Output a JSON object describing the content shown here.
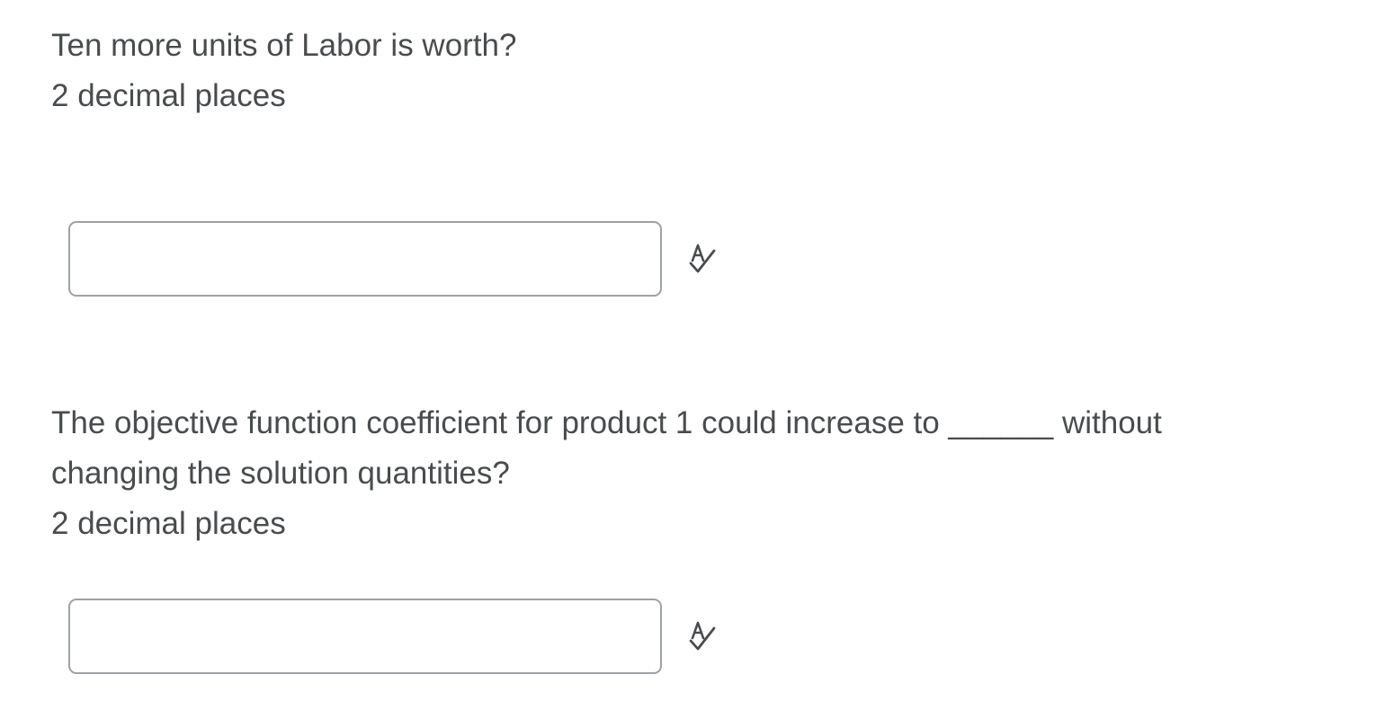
{
  "questions": [
    {
      "lines": [
        "Ten more units of Labor is worth?",
        "2 decimal places"
      ],
      "answer": {
        "value": "",
        "placeholder": ""
      },
      "icon": "spellcheck-icon"
    },
    {
      "lines": [
        "The objective function coefficient for product 1 could increase to ______ without",
        "changing the solution quantities?",
        "2 decimal places"
      ],
      "answer": {
        "value": "",
        "placeholder": ""
      },
      "icon": "spellcheck-icon"
    }
  ],
  "colors": {
    "text": "#494c4e",
    "input_border": "#9ea1a4",
    "icon": "#494c4e"
  }
}
